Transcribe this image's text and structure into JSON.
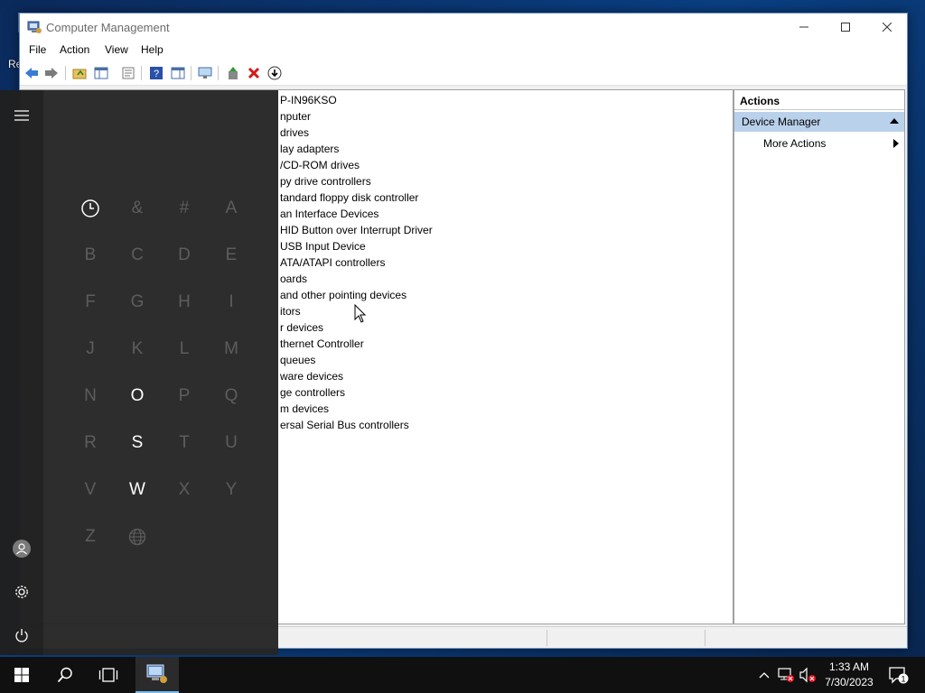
{
  "desktop": {
    "icon_label": "Re"
  },
  "window": {
    "title": "Computer Management",
    "controls": {
      "minimize": "—",
      "maximize": "☐",
      "close": "✕"
    },
    "menu": [
      "File",
      "Action",
      "View",
      "Help"
    ],
    "tree": [
      "P-IN96KSO",
      "nputer",
      "drives",
      "lay adapters",
      "/CD-ROM drives",
      "py drive controllers",
      "tandard floppy disk controller",
      "an Interface Devices",
      "HID Button over Interrupt Driver",
      "USB Input Device",
      "ATA/ATAPI controllers",
      "oards",
      " and other pointing devices",
      "itors",
      "r devices",
      "thernet Controller",
      "queues",
      "ware devices",
      "ge controllers",
      "m devices",
      "ersal Serial Bus controllers"
    ],
    "actions": {
      "header": "Actions",
      "section": "Device Manager",
      "item": "More Actions"
    }
  },
  "start_menu": {
    "letters": [
      {
        "char": "&",
        "enabled": false
      },
      {
        "char": "#",
        "enabled": false
      },
      {
        "char": "A",
        "enabled": false
      },
      {
        "char": "B",
        "enabled": false
      },
      {
        "char": "C",
        "enabled": false
      },
      {
        "char": "D",
        "enabled": false
      },
      {
        "char": "E",
        "enabled": false
      },
      {
        "char": "F",
        "enabled": false
      },
      {
        "char": "G",
        "enabled": false
      },
      {
        "char": "H",
        "enabled": false
      },
      {
        "char": "I",
        "enabled": false
      },
      {
        "char": "J",
        "enabled": false
      },
      {
        "char": "K",
        "enabled": false
      },
      {
        "char": "L",
        "enabled": false
      },
      {
        "char": "M",
        "enabled": false
      },
      {
        "char": "N",
        "enabled": false
      },
      {
        "char": "O",
        "enabled": true
      },
      {
        "char": "P",
        "enabled": false
      },
      {
        "char": "Q",
        "enabled": false
      },
      {
        "char": "R",
        "enabled": false
      },
      {
        "char": "S",
        "enabled": true
      },
      {
        "char": "T",
        "enabled": false
      },
      {
        "char": "U",
        "enabled": false
      },
      {
        "char": "V",
        "enabled": false
      },
      {
        "char": "W",
        "enabled": true
      },
      {
        "char": "X",
        "enabled": false
      },
      {
        "char": "Y",
        "enabled": false
      },
      {
        "char": "Z",
        "enabled": false
      }
    ]
  },
  "taskbar": {
    "time": "1:33 AM",
    "date": "7/30/2023",
    "notification_count": "1"
  },
  "colors": {
    "accent": "#76b9ed",
    "action_section_bg": "#bad1ec",
    "start_bg": "#262626",
    "taskbar_bg": "#101010"
  }
}
